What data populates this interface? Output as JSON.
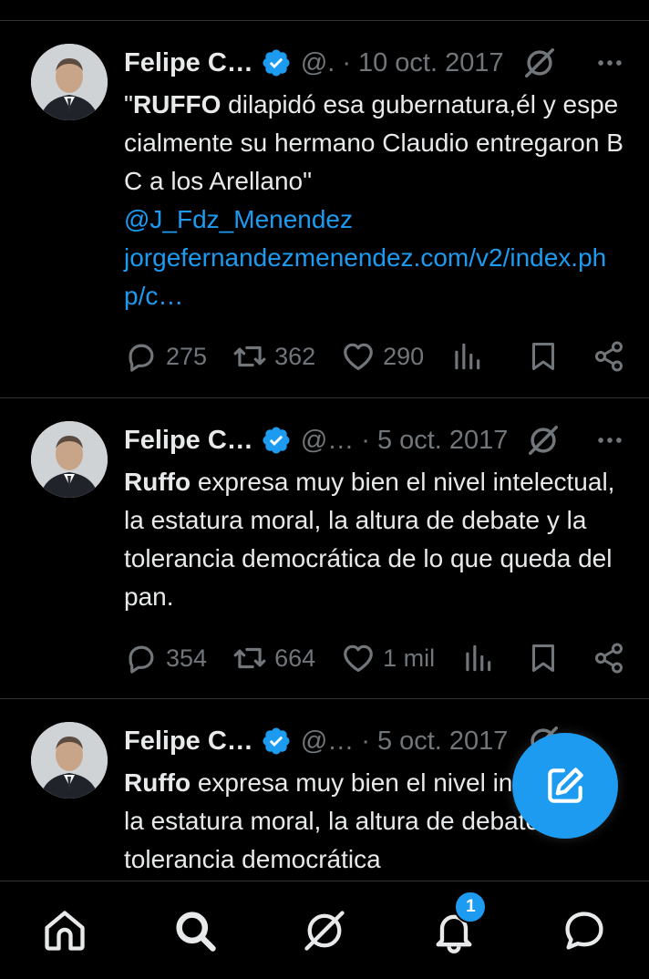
{
  "tweets": [
    {
      "name": "Felipe C…",
      "handle": "@.",
      "dot": "·",
      "date": "10 oct. 2017",
      "text_bold": "RUFFO",
      "text_prefix": "\"",
      "text_rest": " dilapidó esa gubernatura,él y especialmente su hermano Claudio entregaron BC a los Arellano\"",
      "mention": "@J_Fdz_Menendez",
      "url": "jorgefernandezmenendez.com/v2/index.php/c…",
      "replies": "275",
      "retweets": "362",
      "likes": "290"
    },
    {
      "name": "Felipe C…",
      "handle": "@…",
      "dot": "·",
      "date": "5 oct. 2017",
      "text_bold": "Ruffo",
      "text_rest": " expresa muy bien el nivel intelectual, la estatura moral, la altura de debate y la tolerancia democrática de lo que queda del pan.",
      "replies": "354",
      "retweets": "664",
      "likes": "1 mil"
    },
    {
      "name": "Felipe C…",
      "handle": "@…",
      "dot": "·",
      "date": "5 oct. 2017",
      "text_bold": "Ruffo",
      "text_rest": " expresa muy bien el nivel intelectual, la estatura moral, la altura de debate y la tolerancia democrática"
    }
  ],
  "nav": {
    "items": [
      "home-icon",
      "search-icon",
      "grok-icon",
      "notifications-icon",
      "messages-icon"
    ],
    "notification_count": "1"
  },
  "fab": {
    "icon": "compose-icon"
  },
  "colors": {
    "accent": "#1d9bf0",
    "muted": "#71767b",
    "text": "#e7e9ea",
    "background": "#000000"
  }
}
